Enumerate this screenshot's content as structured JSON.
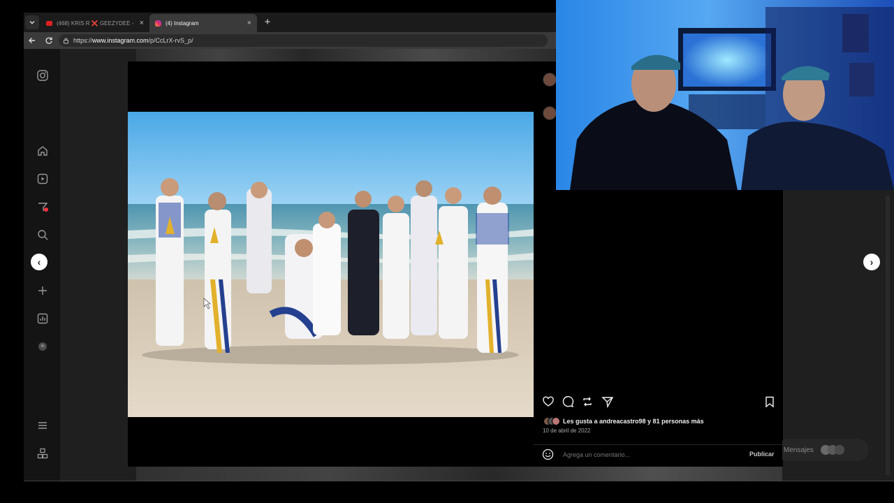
{
  "browser": {
    "tabs": [
      {
        "label": "(468) KRIS R ❌ GEEZYDEE - TUI",
        "active": false
      },
      {
        "label": "(4) Instagram",
        "active": true
      }
    ],
    "url_prefix": "https://",
    "url_host": "www.instagram.com",
    "url_path": "/p/CcLrX-rvS_p/"
  },
  "sidebar": {
    "icons": [
      "instagram-icon",
      "home-icon",
      "reels-icon",
      "notifications-icon",
      "search-icon",
      "create-icon",
      "dashboard-icon",
      "profile-icon",
      "menu-icon",
      "more-apps-icon"
    ],
    "badge_color": "#ff3040"
  },
  "post": {
    "likes_text": "Les gusta a andreacastro98 y 81 personas más",
    "date": "10 de abril de 2022",
    "comment_placeholder": "Agrega un comentario...",
    "publish_label": "Publicar"
  },
  "messages_pill": {
    "label": "Mensajes"
  },
  "colors": {
    "bg": "#000000",
    "panel": "#1f1f1f",
    "accent_sky": "#5fb8ee",
    "uniform_blue": "#1f3f9a",
    "uniform_gold": "#e8b92f"
  }
}
